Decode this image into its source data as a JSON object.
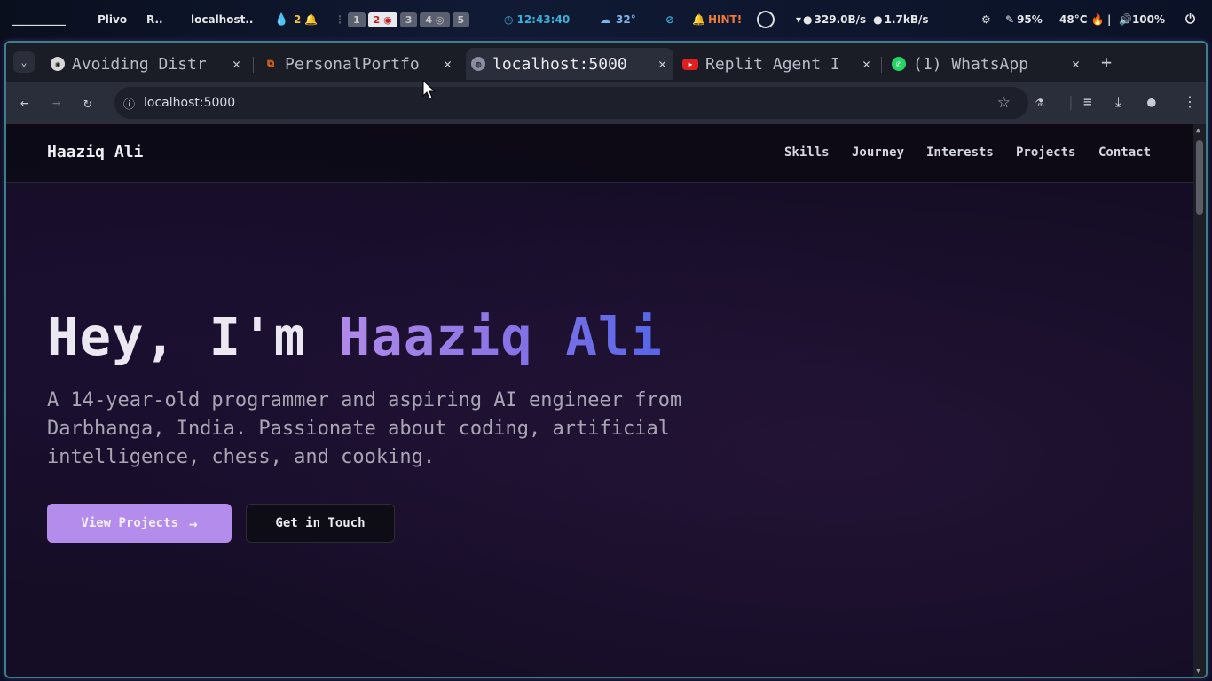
{
  "system_bar": {
    "menu_label": "__________",
    "apps": [
      "Plivo",
      "R..",
      "localhost.."
    ],
    "notification_count": "2",
    "workspaces": [
      "1",
      "2",
      "3",
      "4",
      "5"
    ],
    "clock": "12:43:40",
    "weather": "32°",
    "hint": "HINT!",
    "net_down": "329.0B/s",
    "net_up": "1.7kB/s",
    "brightness": "95%",
    "temperature": "48°C",
    "volume": "100%"
  },
  "browser": {
    "tabs": [
      {
        "title": "Avoiding Distr",
        "favicon": "openai-icon",
        "active": false
      },
      {
        "title": "PersonalPortfo",
        "favicon": "replit-icon",
        "active": false
      },
      {
        "title": "localhost:5000",
        "favicon": "globe-icon",
        "active": true
      },
      {
        "title": "Replit Agent I",
        "favicon": "youtube-icon",
        "active": false
      },
      {
        "title": "(1) WhatsApp",
        "favicon": "whatsapp-icon",
        "active": false
      }
    ],
    "new_tab": "+",
    "url": "localhost:5000"
  },
  "site": {
    "brand": "Haaziq Ali",
    "nav": [
      "Skills",
      "Journey",
      "Interests",
      "Projects",
      "Contact"
    ],
    "hero": {
      "greeting": "Hey, I'm ",
      "name": "Haaziq Ali",
      "subtitle": "A 14-year-old programmer and aspiring AI engineer from Darbhanga, India. Passionate about coding, artificial intelligence, chess, and cooking.",
      "primary_button": "View Projects",
      "secondary_button": "Get in Touch"
    }
  },
  "colors": {
    "accent_purple": "#b48cec",
    "gradient_start": "#b18ae8",
    "gradient_end": "#5566e6",
    "page_bg": "#150d26"
  }
}
